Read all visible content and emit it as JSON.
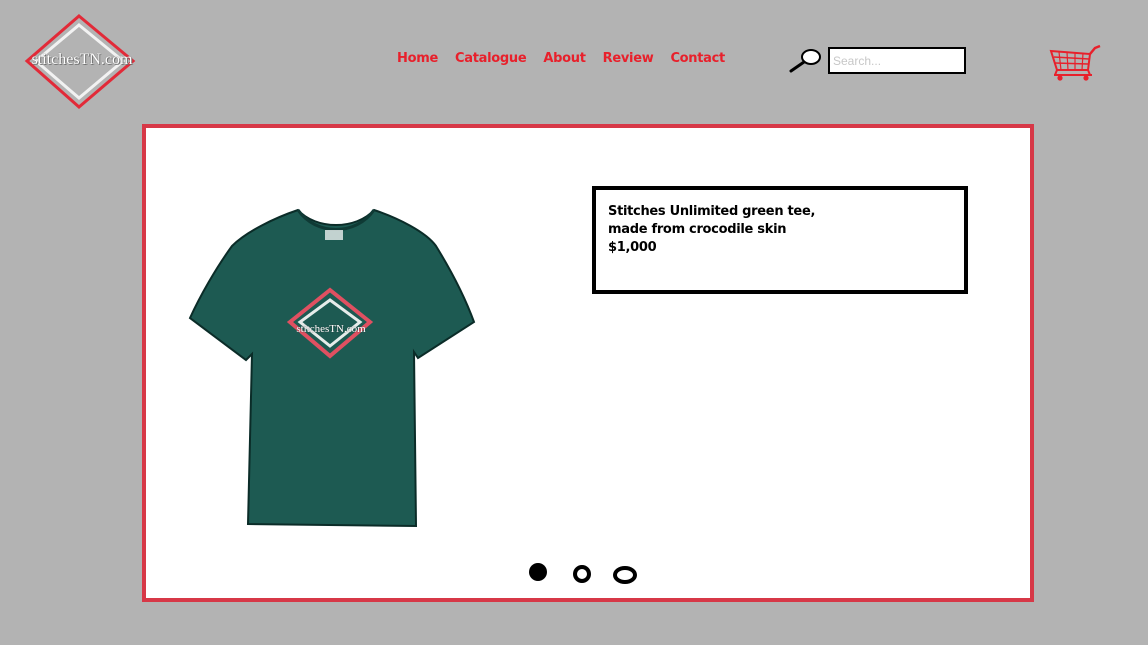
{
  "brand": {
    "logo_text": "stitchesTN.com"
  },
  "nav": {
    "items": [
      {
        "label": "Home"
      },
      {
        "label": "Catalogue"
      },
      {
        "label": "About"
      },
      {
        "label": "Review"
      },
      {
        "label": "Contact"
      }
    ]
  },
  "search": {
    "placeholder": "Search...",
    "value": "",
    "icon": "search-icon"
  },
  "cart": {
    "icon": "shopping-cart-icon"
  },
  "carousel": {
    "product": {
      "name_line1": "Stitches Unlimited green tee,",
      "name_line2": "made from crocodile skin",
      "price": "$1,000",
      "image_logo_text": "stitchesTN.com"
    },
    "slides": {
      "count": 3,
      "active_index": 0
    }
  },
  "colors": {
    "background": "#b3b3b3",
    "accent_red": "#e8202b",
    "carousel_border": "#d73847",
    "shirt_green": "#1d5a52"
  }
}
